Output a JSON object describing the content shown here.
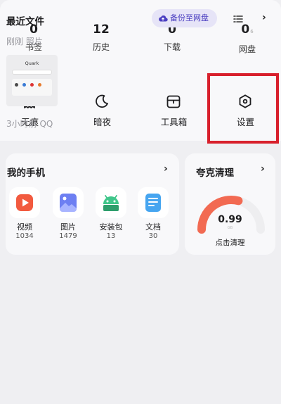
{
  "stats": [
    {
      "count": "0",
      "label": "书签"
    },
    {
      "count": "12",
      "label": "历史"
    },
    {
      "count": "0",
      "label": "下载"
    },
    {
      "count": "0",
      "label": "网盘",
      "badge": "6"
    }
  ],
  "tools": [
    {
      "label": "无痕",
      "icon": "ghost-icon"
    },
    {
      "label": "暗夜",
      "icon": "moon-icon"
    },
    {
      "label": "工具箱",
      "icon": "toolbox-icon"
    },
    {
      "label": "设置",
      "icon": "settings-hexagon-icon"
    }
  ],
  "my_phone": {
    "title": "我的手机",
    "apps": [
      {
        "name": "视频",
        "count": "1034",
        "icon": "video-icon",
        "color": "#f25a3f"
      },
      {
        "name": "图片",
        "count": "1479",
        "icon": "image-icon",
        "color": "#6d7ff2"
      },
      {
        "name": "安装包",
        "count": "13",
        "icon": "android-icon",
        "color": "#3fc68a"
      },
      {
        "name": "文档",
        "count": "30",
        "icon": "document-icon",
        "color": "#46a5f0"
      }
    ]
  },
  "cleaner": {
    "title": "夸克清理",
    "value": "0.99",
    "unit": "GB",
    "action": "点击清理",
    "gauge_fraction": 0.58,
    "gauge_color": "#f26a52"
  },
  "recent": {
    "title": "最近文件",
    "backup_label": "备份至网盘",
    "group1_time": "刚刚",
    "group1_source": "照片",
    "thumb_brand": "Quark",
    "group2_time": "3小时前",
    "group2_source": "QQ"
  },
  "colors": {
    "highlight": "#d8202c",
    "accent": "#4b3fc1"
  }
}
